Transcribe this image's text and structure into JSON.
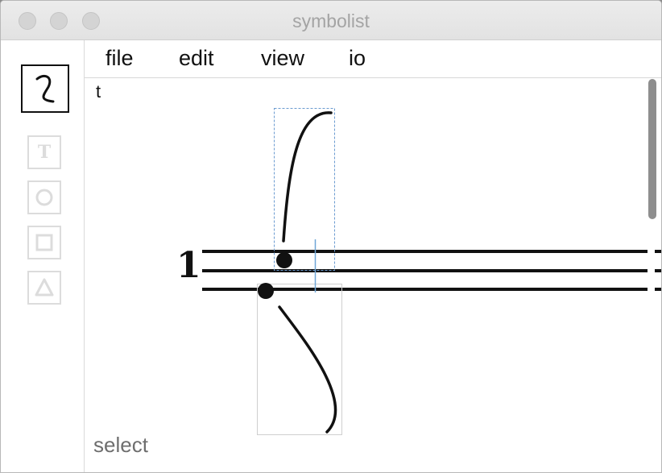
{
  "window": {
    "title": "symbolist"
  },
  "toolbar": {
    "tools": [
      {
        "name": "curve-tool",
        "icon": "curve-icon",
        "active": true
      },
      {
        "name": "text-tool",
        "icon": "text-icon",
        "label": "T",
        "active": false
      },
      {
        "name": "circle-tool",
        "icon": "circle-icon",
        "active": false
      },
      {
        "name": "square-tool",
        "icon": "square-icon",
        "active": false
      },
      {
        "name": "triangle-tool",
        "icon": "triangle-icon",
        "active": false
      }
    ]
  },
  "menu": {
    "file": "file",
    "edit": "edit",
    "view": "view",
    "io": "io"
  },
  "canvas": {
    "corner_label": "t",
    "staff_number": "1",
    "mode": "select"
  },
  "colors": {
    "ink": "#111111",
    "selection": "#5a8fc4",
    "inactive_tool": "#dcdcdc"
  }
}
